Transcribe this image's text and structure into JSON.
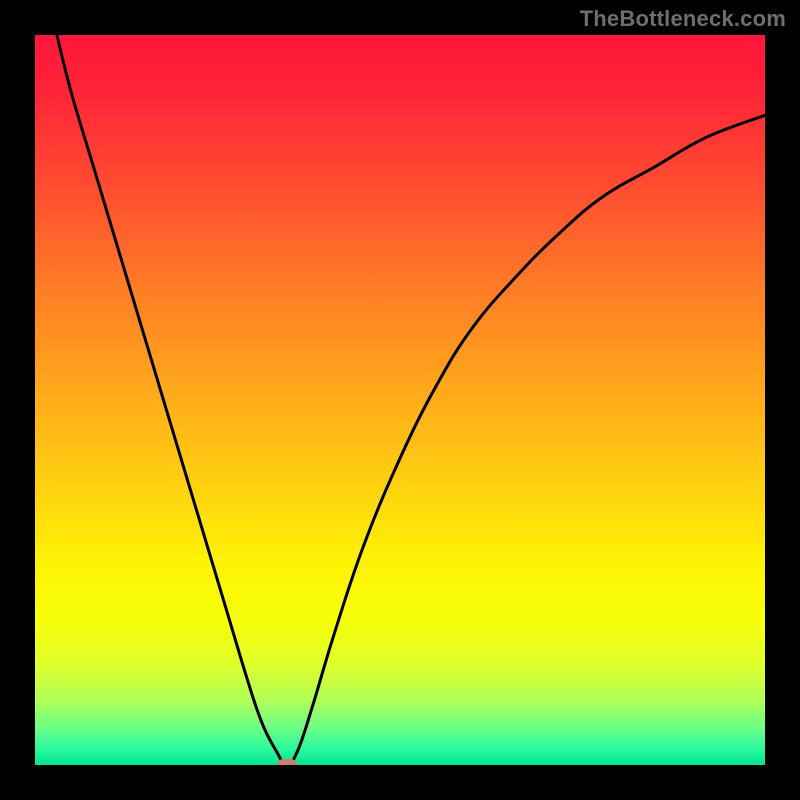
{
  "watermark": "TheBottleneck.com",
  "chart_data": {
    "type": "line",
    "title": "",
    "xlabel": "",
    "ylabel": "",
    "xlim": [
      0,
      100
    ],
    "ylim": [
      0,
      100
    ],
    "axes_visible": false,
    "grid": false,
    "legend": false,
    "background_gradient": {
      "direction": "vertical",
      "stops": [
        {
          "pos": 0.0,
          "color": "#ff173a"
        },
        {
          "pos": 0.07,
          "color": "#ff2238"
        },
        {
          "pos": 0.2,
          "color": "#ff4a31"
        },
        {
          "pos": 0.35,
          "color": "#ff7d26"
        },
        {
          "pos": 0.5,
          "color": "#ffad1a"
        },
        {
          "pos": 0.62,
          "color": "#ffd20f"
        },
        {
          "pos": 0.72,
          "color": "#fff205"
        },
        {
          "pos": 0.8,
          "color": "#f7ff08"
        },
        {
          "pos": 0.86,
          "color": "#e0ff2a"
        },
        {
          "pos": 0.91,
          "color": "#b3ff55"
        },
        {
          "pos": 0.95,
          "color": "#6aff87"
        },
        {
          "pos": 0.98,
          "color": "#26f79e"
        },
        {
          "pos": 1.0,
          "color": "#00e58f"
        }
      ]
    },
    "series": [
      {
        "name": "bottleneck-curve",
        "color": "#000000",
        "x": [
          3,
          5,
          8,
          11,
          14,
          17,
          20,
          23,
          26,
          29,
          31,
          33,
          34.5,
          36,
          38,
          41,
          45,
          50,
          55,
          60,
          66,
          72,
          78,
          85,
          92,
          100
        ],
        "y": [
          100,
          92,
          82,
          72,
          62,
          52,
          42,
          32,
          22,
          12,
          6,
          2,
          0,
          2,
          8,
          18,
          30,
          42,
          52,
          60,
          67,
          73,
          78,
          82,
          86,
          89
        ]
      }
    ],
    "marker": {
      "name": "optimal-point",
      "x": 34.5,
      "y": 0,
      "shape": "pill",
      "color": "#c97f77"
    }
  }
}
